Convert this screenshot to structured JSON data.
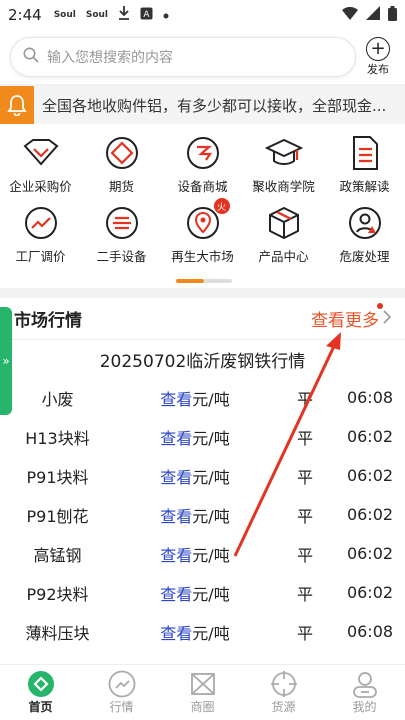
{
  "status": {
    "time": "2:44",
    "icons": [
      "Soul",
      "Soul"
    ]
  },
  "search": {
    "placeholder": "输入您想搜索的内容"
  },
  "publish": {
    "label": "发布"
  },
  "notice": {
    "text": "全国各地收购件铝，有多少都可以接收，全部现金..."
  },
  "grid": {
    "row1": [
      {
        "label": "企业采购价",
        "icon": "handshake-icon"
      },
      {
        "label": "期货",
        "icon": "futures-icon"
      },
      {
        "label": "设备商城",
        "icon": "equipment-icon"
      },
      {
        "label": "聚收商学院",
        "icon": "graduation-cap-icon"
      },
      {
        "label": "政策解读",
        "icon": "document-icon"
      }
    ],
    "row2": [
      {
        "label": "工厂调价",
        "icon": "trend-icon"
      },
      {
        "label": "二手设备",
        "icon": "secondhand-icon"
      },
      {
        "label": "再生大市场",
        "icon": "location-icon",
        "badge": "火"
      },
      {
        "label": "产品中心",
        "icon": "box-icon"
      },
      {
        "label": "危废处理",
        "icon": "hazard-icon"
      }
    ]
  },
  "side_tab": {
    "label": "»"
  },
  "market": {
    "title": "市场行情",
    "more": "查看更多",
    "subtitle": "20250702临沂废钢铁行情",
    "link_text": "查看",
    "rows": [
      {
        "name": "小废",
        "unit": "元/吨",
        "trend": "平",
        "time": "06:08"
      },
      {
        "name": "H13块料",
        "unit": "元/吨",
        "trend": "平",
        "time": "06:02"
      },
      {
        "name": "P91块料",
        "unit": "元/吨",
        "trend": "平",
        "time": "06:02"
      },
      {
        "name": "P91刨花",
        "unit": "元/吨",
        "trend": "平",
        "time": "06:02"
      },
      {
        "name": "高锰钢",
        "unit": "元/吨",
        "trend": "平",
        "time": "06:02"
      },
      {
        "name": "P92块料",
        "unit": "元/吨",
        "trend": "平",
        "time": "06:02"
      },
      {
        "name": "薄料压块",
        "unit": "元/吨",
        "trend": "平",
        "time": "06:08"
      }
    ]
  },
  "tabs": [
    {
      "label": "首页",
      "icon": "home-icon",
      "active": true
    },
    {
      "label": "行情",
      "icon": "market-trend-icon",
      "active": false
    },
    {
      "label": "商圈",
      "icon": "business-circle-icon",
      "active": false
    },
    {
      "label": "货源",
      "icon": "supply-icon",
      "active": false
    },
    {
      "label": "我的",
      "icon": "user-icon",
      "active": false
    }
  ],
  "colors": {
    "accent": "#f08a1c",
    "more": "#e8542a",
    "link": "#2a46c7",
    "green": "#26b56b",
    "arrow": "#e53322"
  }
}
